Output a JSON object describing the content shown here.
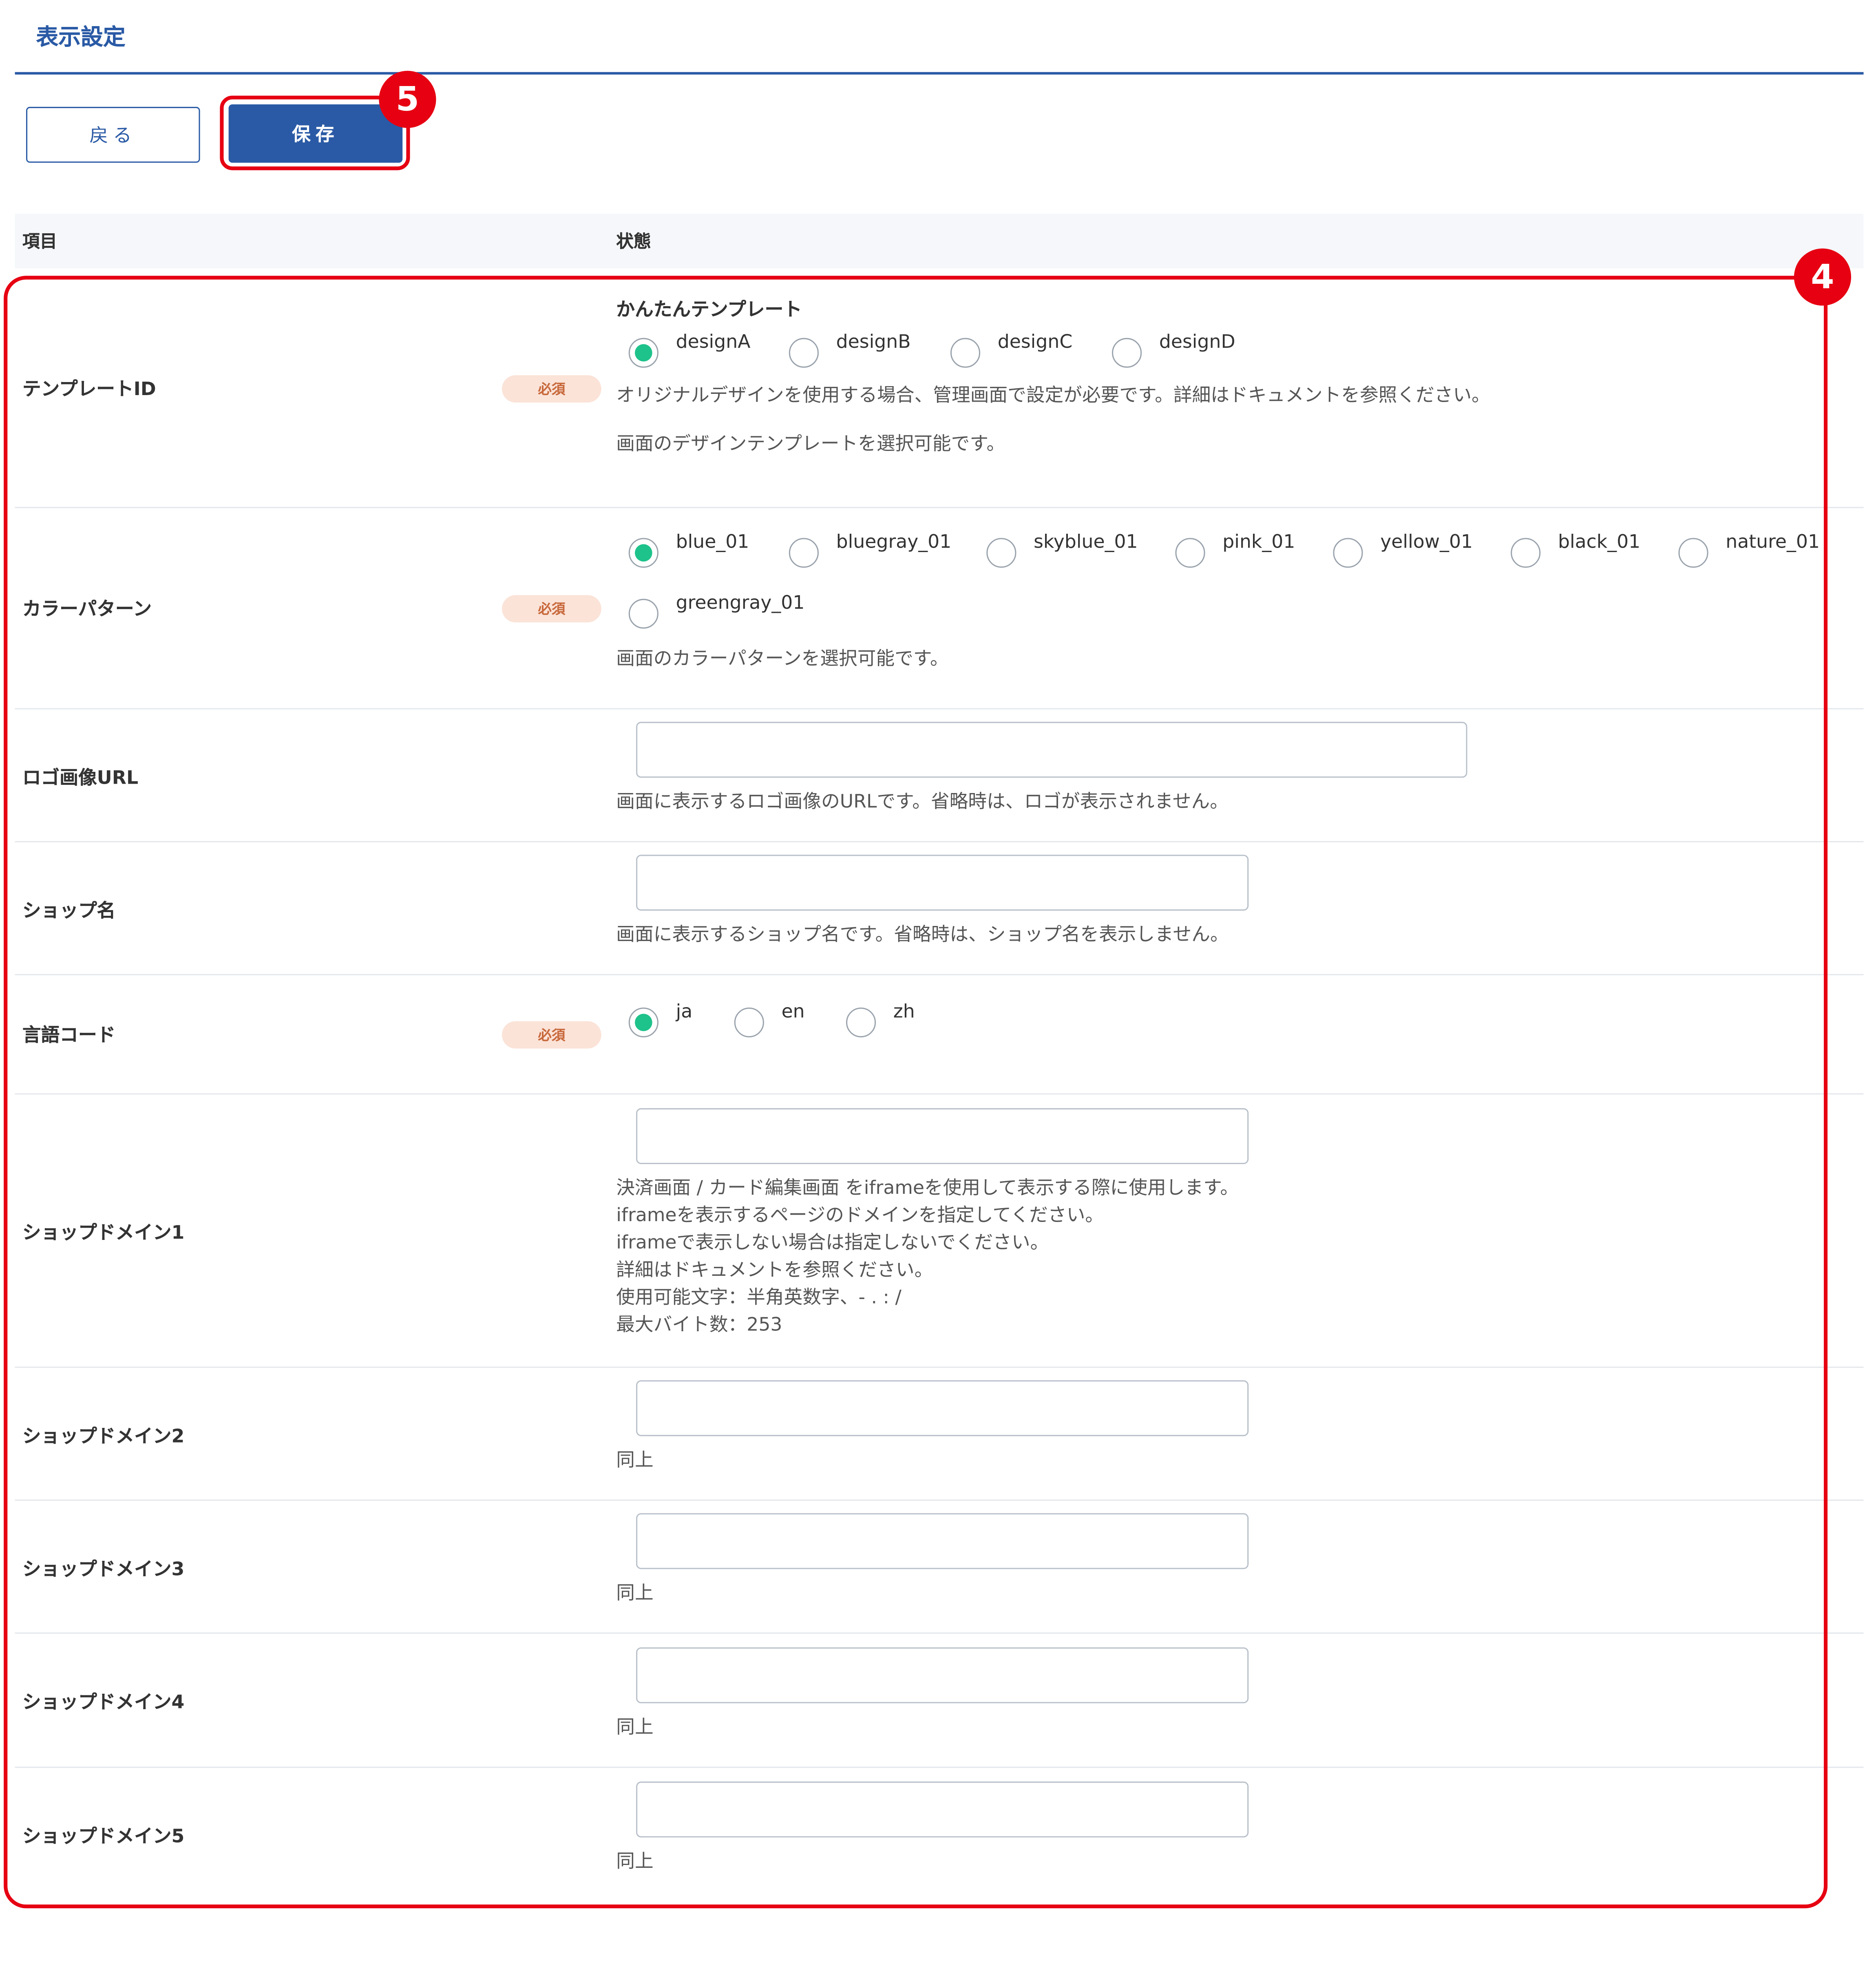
{
  "page": {
    "title": "表示設定",
    "back_label": "戻る",
    "save_label": "保存",
    "callout_save": "5",
    "callout_form": "4"
  },
  "table": {
    "col_item": "項目",
    "col_state": "状態",
    "required_badge": "必須"
  },
  "rows": {
    "template": {
      "label": "テンプレートID",
      "group_title": "かんたんテンプレート",
      "options": [
        "designA",
        "designB",
        "designC",
        "designD"
      ],
      "selected": "designA",
      "notes": [
        "オリジナルデザインを使用する場合、管理画面で設定が必要です。詳細はドキュメントを参照ください。",
        "画面のデザインテンプレートを選択可能です。"
      ]
    },
    "color": {
      "label": "カラーパターン",
      "options": [
        "blue_01",
        "bluegray_01",
        "skyblue_01",
        "pink_01",
        "yellow_01",
        "black_01",
        "nature_01",
        "greengray_01"
      ],
      "selected": "blue_01",
      "note": "画面のカラーパターンを選択可能です。"
    },
    "logo": {
      "label": "ロゴ画像URL",
      "value": "",
      "note": "画面に表示するロゴ画像のURLです。省略時は、ロゴが表示されません。"
    },
    "shop_name": {
      "label": "ショップ名",
      "value": "",
      "note": "画面に表示するショップ名です。省略時は、ショップ名を表示しません。"
    },
    "lang": {
      "label": "言語コード",
      "options": [
        "ja",
        "en",
        "zh"
      ],
      "selected": "ja"
    },
    "domain1": {
      "label": "ショップドメイン1",
      "value": "",
      "notes": [
        "決済画面 / カード編集画面 をiframeを使用して表示する際に使用します。",
        "iframeを表示するページのドメインを指定してください。",
        "iframeで表示しない場合は指定しないでください。",
        "詳細はドキュメントを参照ください。",
        "使用可能文字：半角英数字、- . : /",
        "最大バイト数：253"
      ]
    },
    "domain2": {
      "label": "ショップドメイン2",
      "value": "",
      "note": "同上"
    },
    "domain3": {
      "label": "ショップドメイン3",
      "value": "",
      "note": "同上"
    },
    "domain4": {
      "label": "ショップドメイン4",
      "value": "",
      "note": "同上"
    },
    "domain5": {
      "label": "ショップドメイン5",
      "value": "",
      "note": "同上"
    }
  },
  "colors": {
    "brand": "#2a5aa5",
    "callout": "#e60012",
    "radio_selected": "#1ec28b",
    "required_bg": "#fbe3d8",
    "required_text": "#c8693c"
  }
}
